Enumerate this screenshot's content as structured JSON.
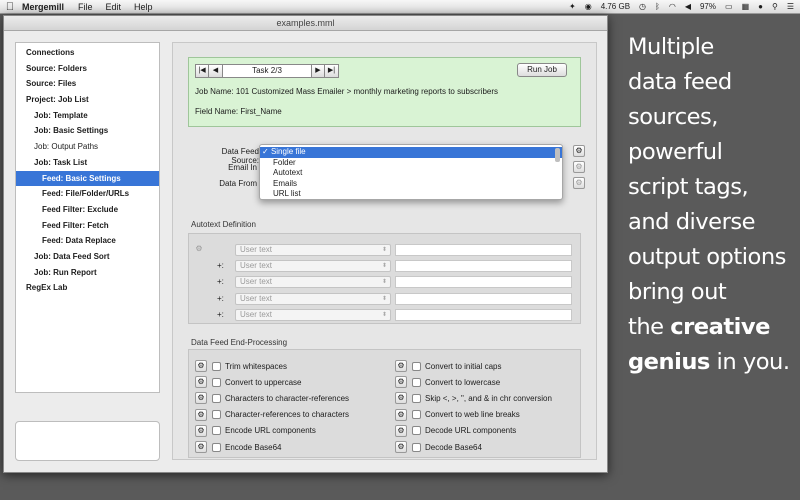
{
  "menubar": {
    "app_name": "Mergemill",
    "menus": [
      "File",
      "Edit",
      "Help"
    ],
    "disk_free": "4.76 GB",
    "battery": "97%"
  },
  "window": {
    "title": "examples.mml"
  },
  "sidebar": {
    "items": [
      {
        "label": "Connections",
        "level": 0,
        "bold": true,
        "selected": false
      },
      {
        "label": "Source: Folders",
        "level": 0,
        "bold": true,
        "selected": false
      },
      {
        "label": "Source: Files",
        "level": 0,
        "bold": true,
        "selected": false
      },
      {
        "label": "Project: Job List",
        "level": 0,
        "bold": true,
        "selected": false
      },
      {
        "label": "Job: Template",
        "level": 1,
        "bold": true,
        "selected": false
      },
      {
        "label": "Job: Basic Settings",
        "level": 1,
        "bold": true,
        "selected": false
      },
      {
        "label": "Job: Output Paths",
        "level": 1,
        "bold": false,
        "selected": false
      },
      {
        "label": "Job: Task List",
        "level": 1,
        "bold": true,
        "selected": false
      },
      {
        "label": "Feed: Basic Settings",
        "level": 2,
        "bold": true,
        "selected": true
      },
      {
        "label": "Feed: File/Folder/URLs",
        "level": 2,
        "bold": true,
        "selected": false
      },
      {
        "label": "Feed Filter: Exclude",
        "level": 2,
        "bold": true,
        "selected": false
      },
      {
        "label": "Feed Filter: Fetch",
        "level": 2,
        "bold": true,
        "selected": false
      },
      {
        "label": "Feed: Data Replace",
        "level": 2,
        "bold": true,
        "selected": false
      },
      {
        "label": "Job: Data Feed Sort",
        "level": 1,
        "bold": true,
        "selected": false
      },
      {
        "label": "Job: Run Report",
        "level": 1,
        "bold": true,
        "selected": false
      },
      {
        "label": "RegEx Lab",
        "level": 0,
        "bold": true,
        "selected": false
      }
    ]
  },
  "task": {
    "label": "Task 2/3",
    "run_button": "Run Job",
    "job_name": "Job Name: 101 Customized Mass Emailer > monthly marketing reports to subscribers",
    "field_name": "Field Name: First_Name"
  },
  "form": {
    "data_feed_source_label": "Data Feed Source:",
    "email_label": "Email In",
    "data_from_label": "Data From"
  },
  "popup": {
    "items": [
      {
        "label": "Single file",
        "checked": true
      },
      {
        "label": "Folder",
        "checked": false
      },
      {
        "label": "Autotext",
        "checked": false
      },
      {
        "label": "Emails",
        "checked": false
      },
      {
        "label": "URL list",
        "checked": false
      }
    ]
  },
  "autotext": {
    "title": "Autotext Definition",
    "rows": [
      {
        "prefix": "",
        "select": "User text"
      },
      {
        "prefix": "+:",
        "select": "User text"
      },
      {
        "prefix": "+:",
        "select": "User text"
      },
      {
        "prefix": "+:",
        "select": "User text"
      },
      {
        "prefix": "+:",
        "select": "User text"
      }
    ]
  },
  "endproc": {
    "title": "Data Feed End-Processing",
    "left": [
      "Trim whitespaces",
      "Convert to uppercase",
      "Characters to character-references",
      "Character-references to characters",
      "Encode URL components",
      "Encode Base64"
    ],
    "right": [
      "Convert to initial caps",
      "Convert to lowercase",
      "Skip <, >, \", and & in chr conversion",
      "Convert to web line breaks",
      "Decode URL components",
      "Decode Base64"
    ]
  },
  "promo": {
    "line1": "Multiple",
    "line2": "data feed",
    "line3": "sources,",
    "line4": "powerful",
    "line5": "script tags,",
    "line6": "and diverse",
    "line7": "output options",
    "line8": "bring out",
    "line9_pre": "the ",
    "line9_bold": "creative",
    "line10_bold": "genius",
    "line10_post": " in you."
  }
}
